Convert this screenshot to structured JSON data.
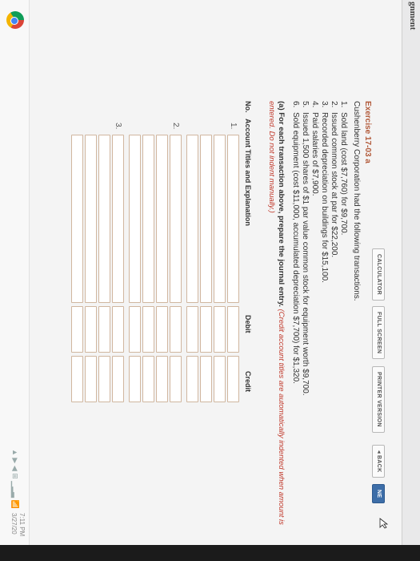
{
  "header": {
    "title": "gnment"
  },
  "toolbar": {
    "calculator": "CALCULATOR",
    "full_screen": "FULL SCREEN",
    "printer_version": "PRINTER VERSION",
    "back": "◂ BACK",
    "next": "NE"
  },
  "exercise": {
    "title": "Exercise 17-03 a",
    "intro": "Cushenberry Corporation had the following transactions.",
    "transactions": [
      {
        "num": "1.",
        "text": "Sold land (cost $7,760) for $9,700."
      },
      {
        "num": "2.",
        "text": "Issued common stock at par for $22,200."
      },
      {
        "num": "3.",
        "text": "Recorded depreciation on buildings for $15,100."
      },
      {
        "num": "4.",
        "text": "Paid salaries of $7,900."
      },
      {
        "num": "5.",
        "text": "Issued 1,500 shares of $1 par value common stock for equipment worth $9,700."
      },
      {
        "num": "6.",
        "text": "Sold equipment (cost $11,000, accumulated depreciation $7,700) for $1,320."
      }
    ],
    "instruction_lead": "(a) For each transaction above, prepare the journal entry.",
    "instruction_note": "(Credit account titles are automatically indented when amount is entered. Do not indent manually.)"
  },
  "table": {
    "headers": {
      "no": "No.",
      "account": "Account Titles and Explanation",
      "debit": "Debit",
      "credit": "Credit"
    },
    "rows": [
      {
        "no": "1."
      },
      {
        "no": "2."
      },
      {
        "no": "3."
      }
    ]
  },
  "taskbar": {
    "tray": "▲ ▶ ◀ ⊞ ▁▂▃ 📶",
    "clock_time": "7:11 PM",
    "clock_date": "3/27/20"
  }
}
